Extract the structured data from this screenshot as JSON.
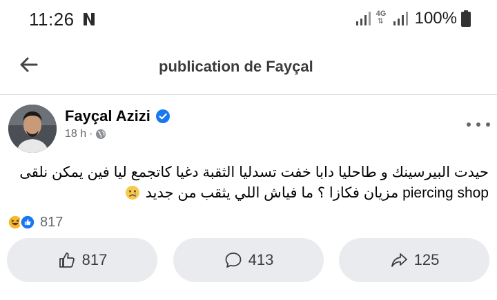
{
  "status_bar": {
    "time": "11:26",
    "network": "4G",
    "battery_percent": "100%",
    "icons": [
      "netflix-n-icon",
      "signal-icon",
      "lte-icon",
      "signal-icon",
      "battery-icon"
    ]
  },
  "header": {
    "title": "publication de Fayçal",
    "back_icon": "arrow-left-icon"
  },
  "post": {
    "author": "Fayçal Azizi",
    "verified": true,
    "time": "18 h",
    "separator": "·",
    "audience_icon": "globe-icon",
    "text": "حيدت البيرسينك و طاحليا دابا خفت تسدليا الثقبة دغيا كاتجمع ليا فين يمكن نلقى piercing shop مزيان فكازا ؟ ما فياش اللي يثقب من جديد",
    "text_emoji": "sad-tear-emoji",
    "reactions": {
      "count": "817",
      "types": [
        "laugh-reaction",
        "like-reaction"
      ]
    },
    "actions": {
      "like_count": "817",
      "comment_count": "413",
      "share_count": "125"
    }
  },
  "colors": {
    "verified_blue": "#1877f2",
    "secondary_text": "#65676b",
    "button_bg": "#e9ebee"
  }
}
